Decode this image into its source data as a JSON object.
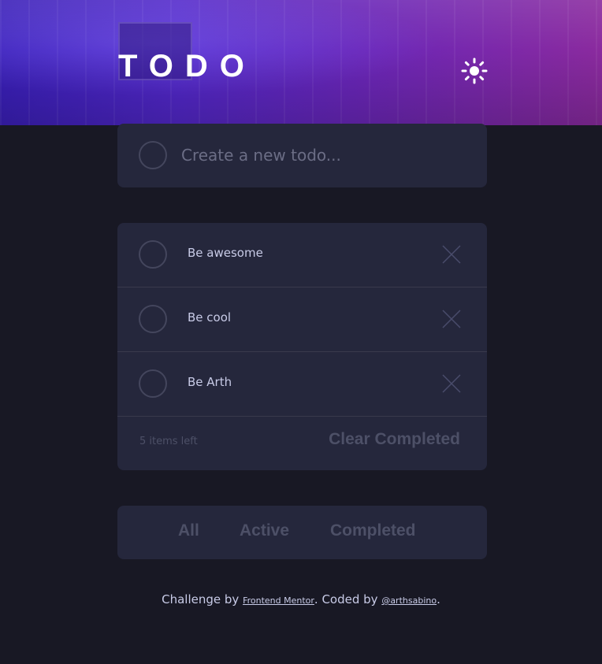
{
  "header": {
    "title": "TODO",
    "theme_toggle_icon": "sun-icon"
  },
  "new_todo": {
    "placeholder": "Create a new todo..."
  },
  "todos": [
    {
      "text": "Be awesome",
      "completed": false
    },
    {
      "text": "Be cool",
      "completed": false
    },
    {
      "text": "Be Arth",
      "completed": false
    }
  ],
  "list_footer": {
    "items_left": "5 items left",
    "clear_label": "Clear Completed"
  },
  "filters": {
    "all": "All",
    "active": "Active",
    "completed": "Completed"
  },
  "attribution": {
    "prefix": "Challenge by ",
    "challenge_link": "Frontend Mentor",
    "middle": ". Coded by ",
    "author_link": "@arthsabino",
    "suffix": "."
  },
  "colors": {
    "background": "#181824",
    "card": "#25273c",
    "text": "#c8cbe7",
    "muted": "#4d5067",
    "divider": "#393a4c",
    "gradient_start": "#3a1fb8",
    "gradient_end": "#8a2a9e"
  }
}
